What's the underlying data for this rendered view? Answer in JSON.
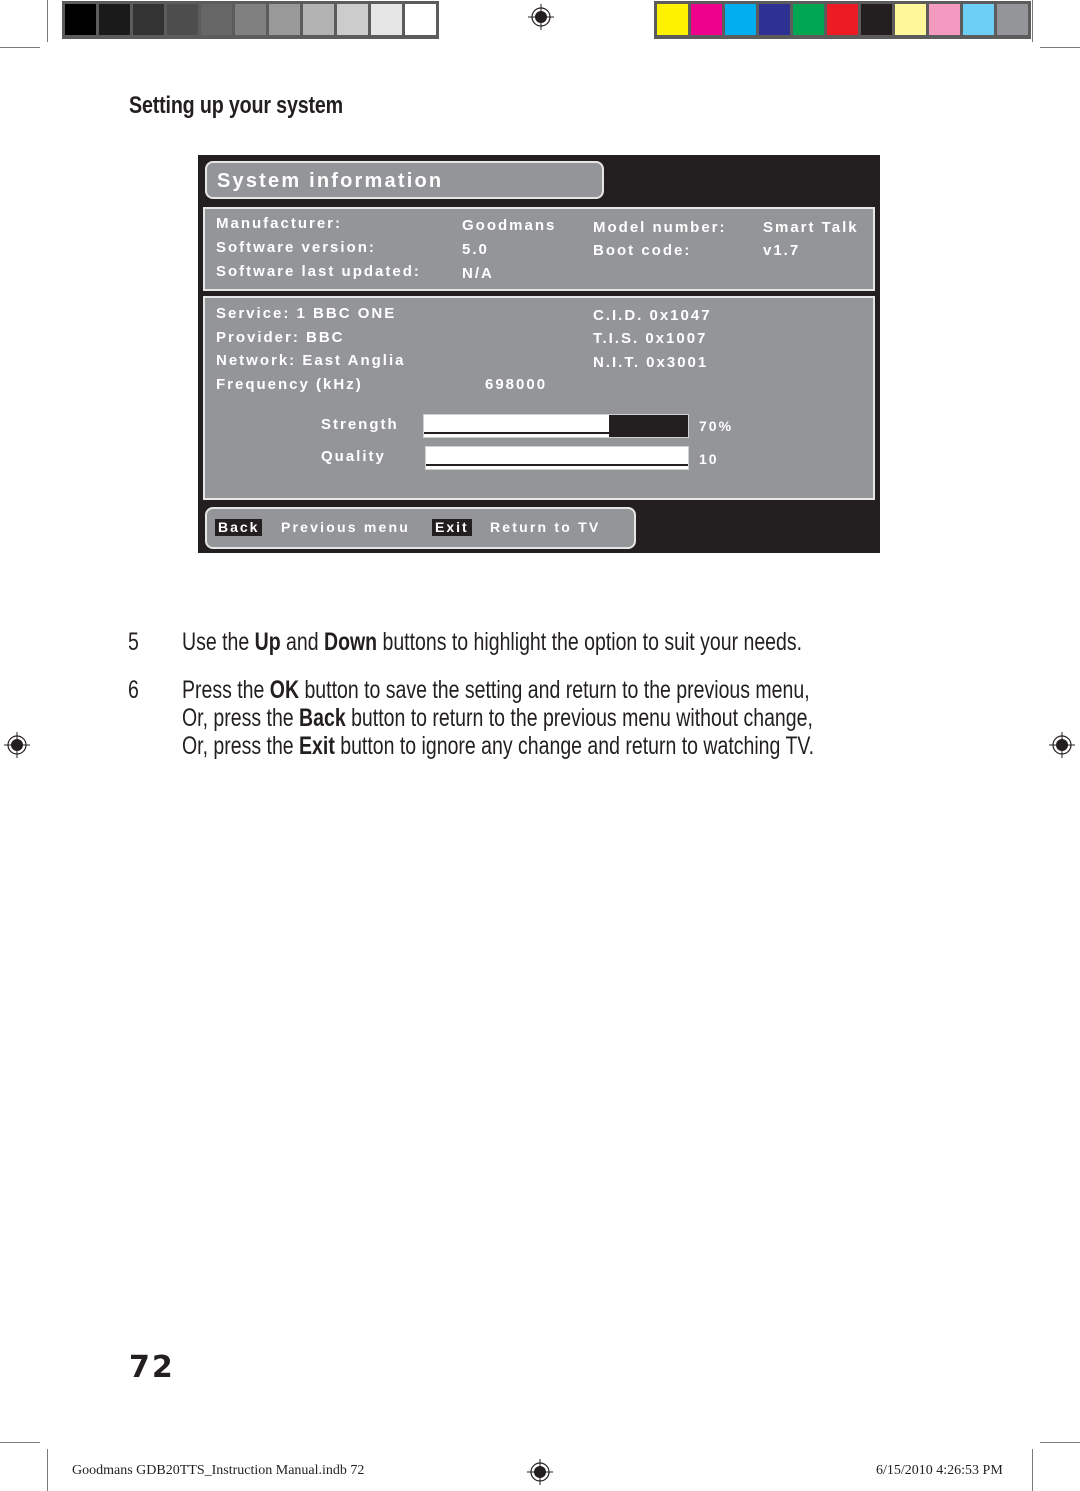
{
  "print_marks": {
    "grayscale_bar": [
      "#000000",
      "#1a1a1a",
      "#333333",
      "#4d4d4d",
      "#666666",
      "#808080",
      "#999999",
      "#b3b3b3",
      "#cccccc",
      "#e6e6e6",
      "#ffffff"
    ],
    "color_bar": [
      "#fff200",
      "#ec008c",
      "#00aeef",
      "#2e3192",
      "#00a651",
      "#ed1c24",
      "#231f20",
      "#fff799",
      "#f49ac1",
      "#6dcff6",
      "#939598"
    ]
  },
  "heading": "Setting up your system",
  "screen": {
    "title": "System information",
    "device_info": {
      "left": [
        {
          "label": "Manufacturer:",
          "value": "Goodmans"
        },
        {
          "label": "Software version:",
          "value": "5.0"
        },
        {
          "label": "Software last updated:",
          "value": "N/A"
        }
      ],
      "right": [
        {
          "label": "Model number:",
          "value": "Smart Talk"
        },
        {
          "label": "Boot code:",
          "value": "v1.7"
        }
      ]
    },
    "service_info": {
      "service": "Service: 1 BBC ONE",
      "provider": "Provider: BBC",
      "network": "Network: East Anglia",
      "frequency_label": "Frequency (kHz)",
      "frequency_value": "698000",
      "cid": "C.I.D. 0x1047",
      "tis": "T.I.S.  0x1007",
      "nit": "N.I.T.  0x3001"
    },
    "signal": {
      "strength_label": "Strength",
      "strength_value": "70%",
      "strength_fill_fraction": 0.7,
      "quality_label": "Quality",
      "quality_value": "10",
      "quality_fill_fraction": 1.0
    },
    "footer": {
      "back_key": "Back",
      "back_desc": "Previous menu",
      "exit_key": "Exit",
      "exit_desc": "Return to TV"
    }
  },
  "steps": [
    {
      "number": "5",
      "lines": [
        [
          {
            "t": "Use the "
          },
          {
            "t": "Up",
            "b": true
          },
          {
            "t": " and "
          },
          {
            "t": "Down",
            "b": true
          },
          {
            "t": " buttons to highlight the option to suit your needs."
          }
        ]
      ]
    },
    {
      "number": "6",
      "lines": [
        [
          {
            "t": "Press the "
          },
          {
            "t": "OK",
            "b": true
          },
          {
            "t": " button to save the setting and return to the previous menu,"
          }
        ],
        [
          {
            "t": "Or, press the "
          },
          {
            "t": "Back",
            "b": true
          },
          {
            "t": " button to return to the previous menu without change,"
          }
        ],
        [
          {
            "t": "Or, press the "
          },
          {
            "t": "Exit",
            "b": true
          },
          {
            "t": " button to ignore any change and return to watching TV."
          }
        ]
      ]
    }
  ],
  "page_number": "72",
  "slug": {
    "file": "Goodmans GDB20TTS_Instruction Manual.indb   72",
    "timestamp": "6/15/2010   4:26:53 PM"
  }
}
